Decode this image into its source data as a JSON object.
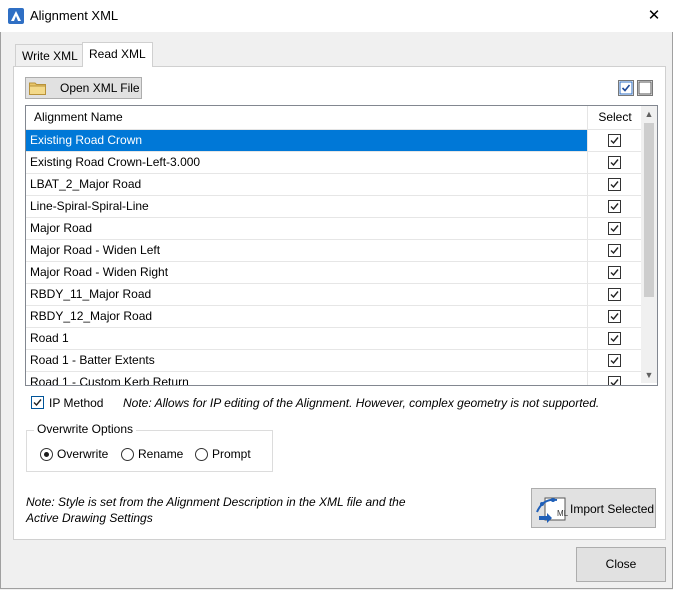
{
  "window": {
    "title": "Alignment XML",
    "close_glyph": "✕",
    "app_icon": "bricscad-logo-icon"
  },
  "tabs": [
    {
      "label": "Write XML",
      "active": false
    },
    {
      "label": "Read XML",
      "active": true
    }
  ],
  "toolbar": {
    "open_label": "Open XML File",
    "open_icon": "folder-icon",
    "check_all_icon": "check-all-icon",
    "uncheck_all_icon": "uncheck-all-icon"
  },
  "grid": {
    "columns": [
      "Alignment Name",
      "Select"
    ],
    "rows": [
      {
        "name": "Existing Road Crown",
        "checked": true,
        "selected": true
      },
      {
        "name": "Existing Road Crown-Left-3.000",
        "checked": true
      },
      {
        "name": "LBAT_2_Major Road",
        "checked": true
      },
      {
        "name": "Line-Spiral-Spiral-Line",
        "checked": true
      },
      {
        "name": "Major Road",
        "checked": true
      },
      {
        "name": "Major Road - Widen Left",
        "checked": true
      },
      {
        "name": "Major Road - Widen Right",
        "checked": true
      },
      {
        "name": "RBDY_11_Major Road",
        "checked": true
      },
      {
        "name": "RBDY_12_Major Road",
        "checked": true
      },
      {
        "name": "Road 1",
        "checked": true
      },
      {
        "name": "Road 1 - Batter Extents",
        "checked": true
      },
      {
        "name": "Road 1 - Custom Kerb Return",
        "checked": true
      }
    ],
    "scroll_up_glyph": "▲",
    "scroll_down_glyph": "▼"
  },
  "ip_method": {
    "label": "IP Method",
    "checked": true,
    "note": "Note: Allows for IP editing of the Alignment. However, complex geometry is not supported."
  },
  "overwrite_options": {
    "title": "Overwrite Options",
    "options": [
      "Overwrite",
      "Rename",
      "Prompt"
    ],
    "selected": "Overwrite"
  },
  "style_note": "Note: Style is set from the Alignment Description in the XML file and the Active Drawing Settings",
  "import_button": {
    "label": "Import Selected",
    "icon": "import-alignment-icon"
  },
  "close_button": {
    "label": "Close"
  },
  "colors": {
    "selection": "#0078d7",
    "window_bg": "#f0f0f0",
    "panel_bg": "#ffffff"
  }
}
